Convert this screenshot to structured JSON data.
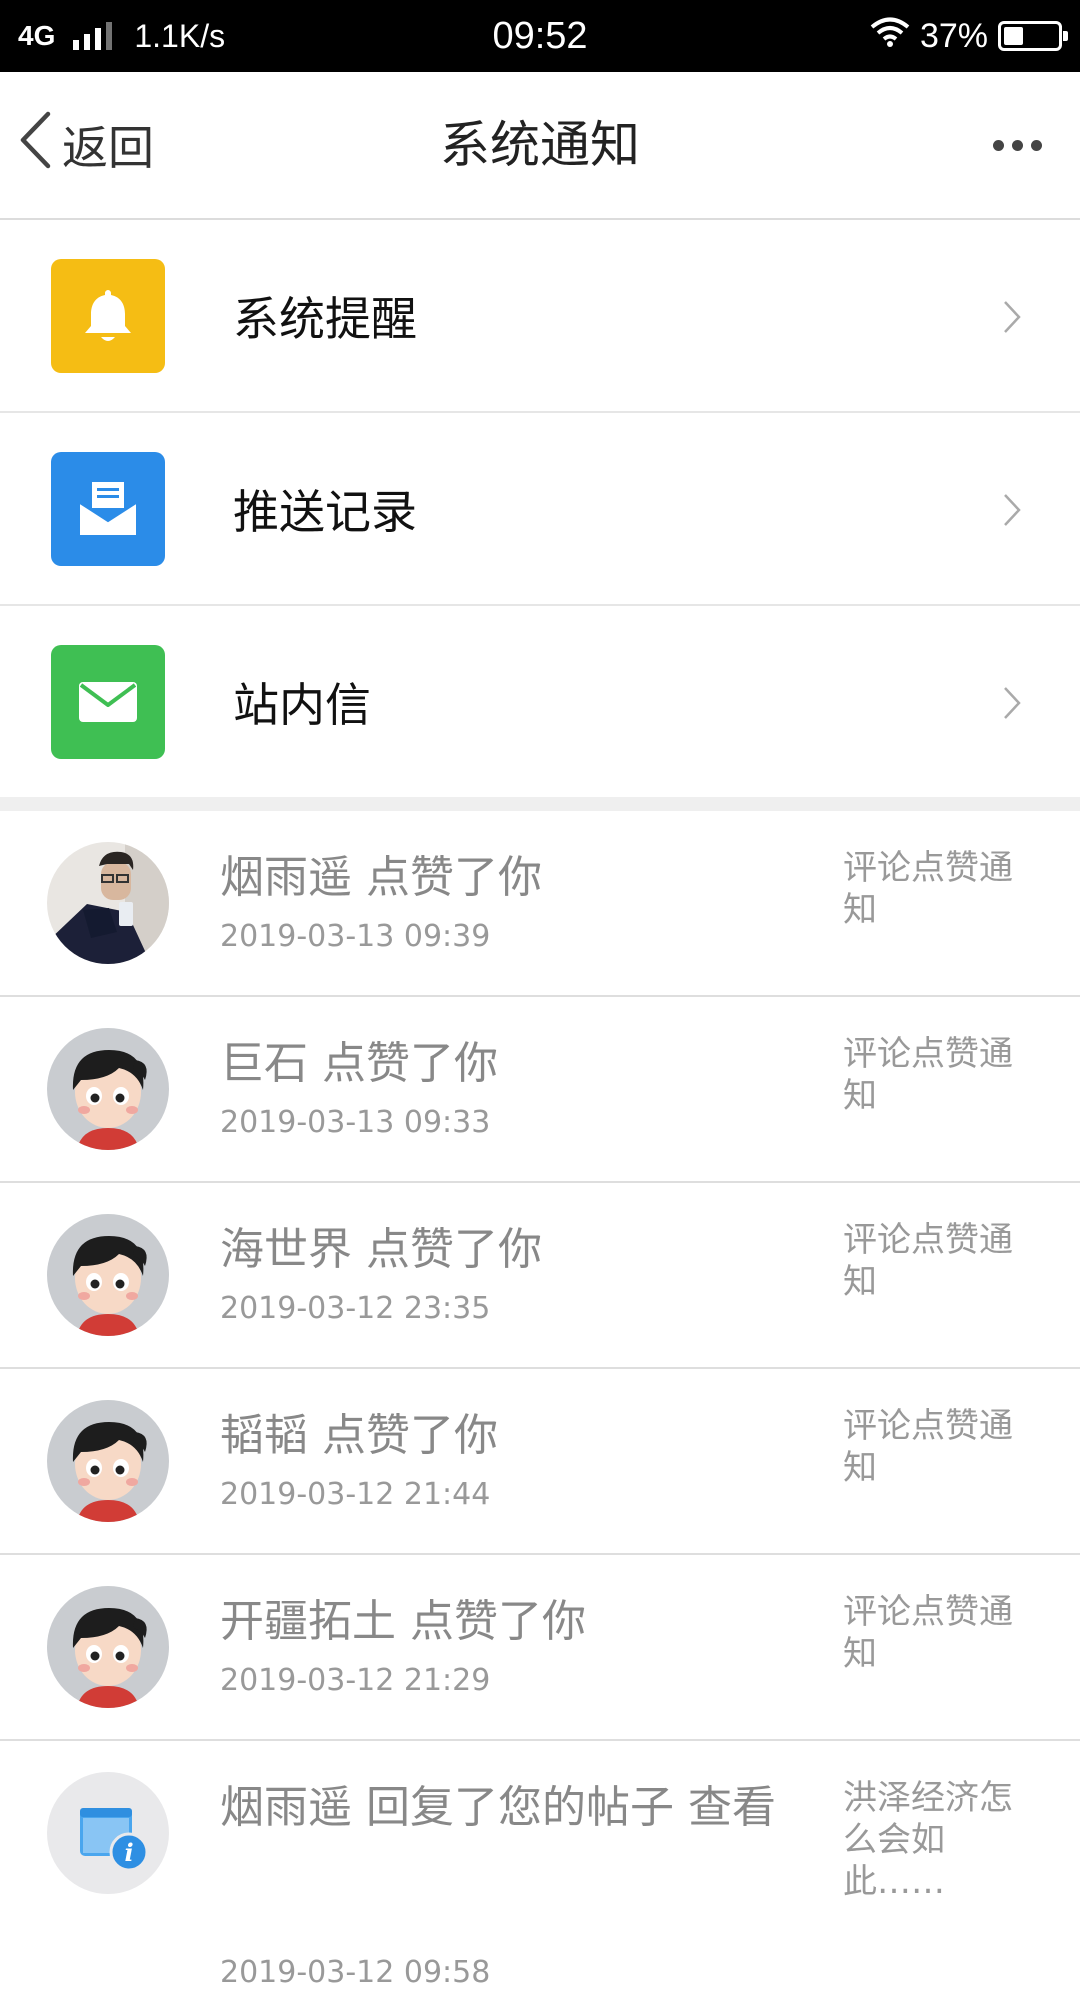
{
  "status_bar": {
    "network": "4G",
    "speed": "1.1K/s",
    "time": "09:52",
    "battery": "37%",
    "battery_level": 0.37
  },
  "header": {
    "back_label": "返回",
    "title": "系统通知"
  },
  "menu": [
    {
      "label": "系统提醒",
      "icon": "bell-icon",
      "color": "#f5bd14"
    },
    {
      "label": "推送记录",
      "icon": "envelope-open-icon",
      "color": "#2b8ce8"
    },
    {
      "label": "站内信",
      "icon": "mail-icon",
      "color": "#3fbf53"
    }
  ],
  "notifications": [
    {
      "title": "烟雨遥 点赞了你",
      "time": "2019-03-13 09:39",
      "tag": "评论点赞通知",
      "avatar": "photo-avatar"
    },
    {
      "title": "巨石 点赞了你",
      "time": "2019-03-13 09:33",
      "tag": "评论点赞通知",
      "avatar": "cartoon-avatar"
    },
    {
      "title": "海世界 点赞了你",
      "time": "2019-03-12 23:35",
      "tag": "评论点赞通知",
      "avatar": "cartoon-avatar"
    },
    {
      "title": "韬韬 点赞了你",
      "time": "2019-03-12 21:44",
      "tag": "评论点赞通知",
      "avatar": "cartoon-avatar"
    },
    {
      "title": "开疆拓土 点赞了你",
      "time": "2019-03-12 21:29",
      "tag": "评论点赞通知",
      "avatar": "cartoon-avatar"
    },
    {
      "title": "烟雨遥 回复了您的帖子 查看",
      "time": "2019-03-12 09:58",
      "tag": "洪泽经济怎么会如此……",
      "avatar": "info-avatar"
    }
  ]
}
